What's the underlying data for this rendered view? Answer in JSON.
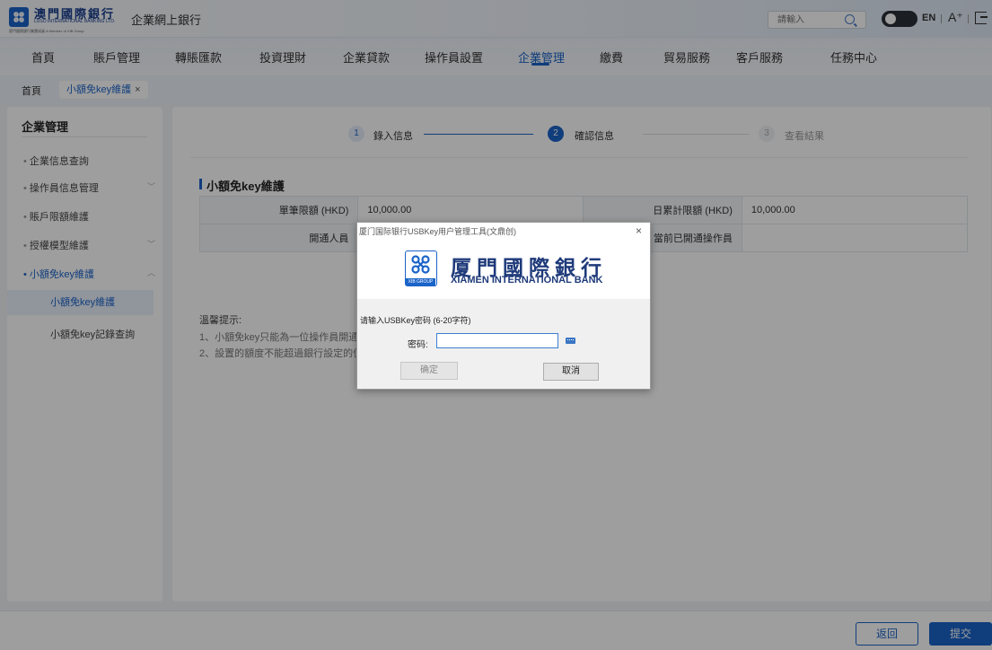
{
  "header": {
    "bank_name_zh": "澳門國際銀行",
    "bank_name_en": "LUSO INTERNATIONAL BANKING LTD.",
    "bank_subtitle": "廈門國際銀行集團成員 A Member of XIB Group",
    "system_name": "企業網上銀行",
    "search_placeholder": "請輸入",
    "lang_label": "EN",
    "font_label": "A⁺"
  },
  "nav": {
    "items": [
      {
        "label": "首頁"
      },
      {
        "label": "賬戶管理"
      },
      {
        "label": "轉賬匯款"
      },
      {
        "label": "投資理財"
      },
      {
        "label": "企業貸款"
      },
      {
        "label": "操作員設置"
      },
      {
        "label": "企業管理"
      },
      {
        "label": "繳費"
      },
      {
        "label": "貿易服務"
      },
      {
        "label": "客戶服務"
      },
      {
        "label": "任務中心"
      }
    ],
    "active_index": 6
  },
  "breadcrumb": {
    "home": "首頁",
    "tab": "小額免key維護",
    "close": "×"
  },
  "sidebar": {
    "title": "企業管理",
    "items": [
      {
        "label": "企業信息查詢"
      },
      {
        "label": "操作員信息管理"
      },
      {
        "label": "賬戶限額維護"
      },
      {
        "label": "授權模型維護"
      },
      {
        "label": "小額免key維護"
      }
    ],
    "subitems": [
      {
        "label": "小額免key維護"
      },
      {
        "label": "小額免key記錄查詢"
      }
    ]
  },
  "steps": [
    {
      "num": "1",
      "label": "錄入信息"
    },
    {
      "num": "2",
      "label": "確認信息"
    },
    {
      "num": "3",
      "label": "查看結果"
    }
  ],
  "section": {
    "title": "小額免key維護",
    "rows": [
      {
        "label1": "單筆限額 (HKD)",
        "value1": "10,000.00",
        "label2": "日累計限額 (HKD)",
        "value2": "10,000.00"
      },
      {
        "label1": "開通人員",
        "value1": "",
        "label2": "當前已開通操作員",
        "value2": ""
      }
    ]
  },
  "tips": {
    "title": "溫馨提示:",
    "items": [
      "1、小額免key只能為一位操作員開通",
      "2、設置的額度不能超過銀行設定的值"
    ]
  },
  "footer": {
    "back_label": "返回",
    "submit_label": "提交"
  },
  "dialog": {
    "title": "厦门国际银行USBKey用户管理工具(文鼎创)",
    "close": "×",
    "logo_group": "XIB GROUP",
    "bank_name_zh": "厦門國際銀行",
    "bank_name_en": "XIAMEN INTERNATIONAL BANK",
    "prompt": "请输入USBKey密码 (6-20字符)",
    "password_label": "密码:",
    "password_value": "",
    "ok_label": "确定",
    "cancel_label": "取消"
  },
  "colors": {
    "primary": "#1a63c9",
    "brand_navy": "#1b3f8f"
  }
}
